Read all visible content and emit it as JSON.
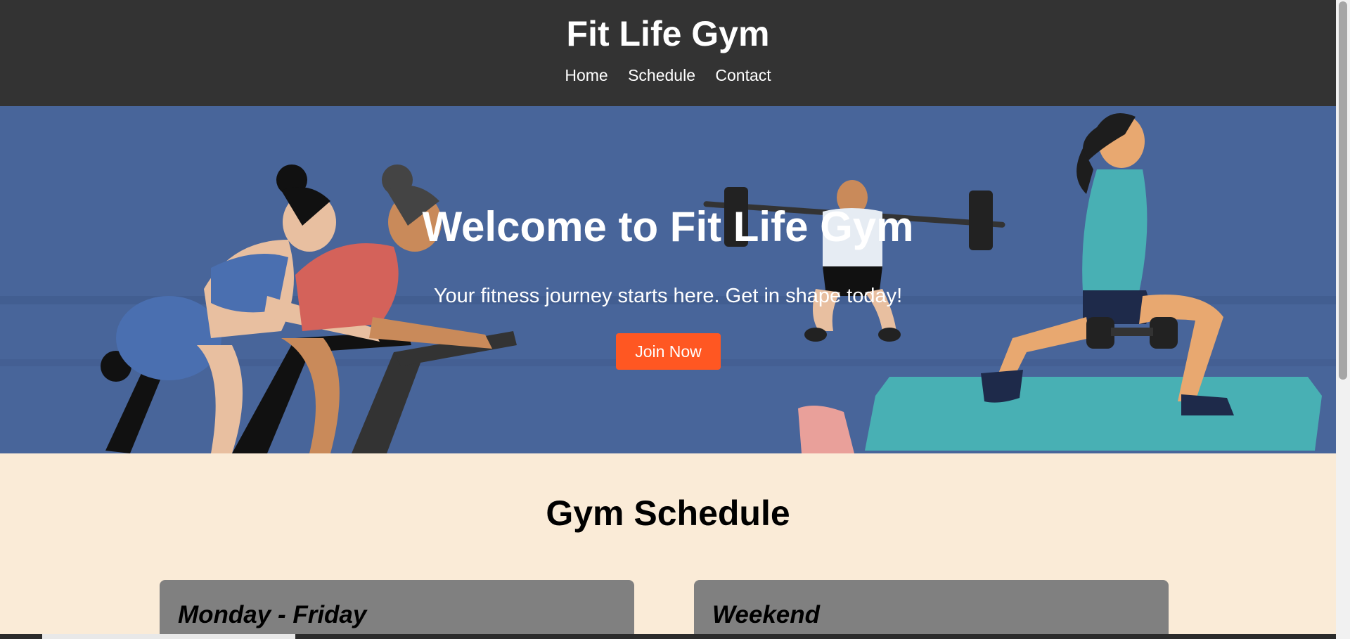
{
  "header": {
    "title": "Fit Life Gym",
    "nav": [
      "Home",
      "Schedule",
      "Contact"
    ]
  },
  "hero": {
    "title": "Welcome to Fit Life Gym",
    "subtitle": "Your fitness journey starts here. Get in shape today!",
    "cta_label": "Join Now",
    "cta_color": "#ff5722"
  },
  "schedule": {
    "title": "Gym Schedule",
    "cards": [
      "Monday - Friday",
      "Weekend"
    ]
  },
  "colors": {
    "header_bg": "#333333",
    "hero_bg": "#48659a",
    "page_bg": "#faebd7",
    "card_bg": "#808080"
  }
}
